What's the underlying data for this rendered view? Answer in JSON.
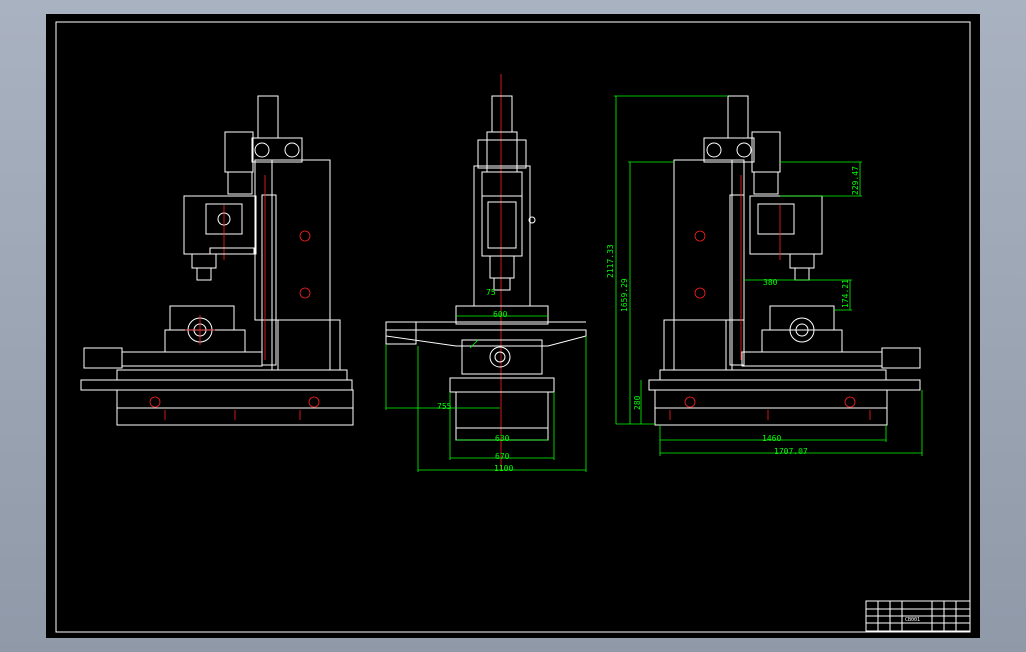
{
  "colors": {
    "background": "#000000",
    "geometry": "#ffffff",
    "dimensions": "#00ff00",
    "centerlines": "#ff2020",
    "chrome": "#9aa3b1"
  },
  "dimensions": {
    "front": {
      "d600": "600",
      "d75": "75",
      "d755": "755",
      "d630": "630",
      "d670": "670",
      "d1100": "1100"
    },
    "side": {
      "d2117": "2117.33",
      "d1659": "1659.29",
      "d229": "229.47",
      "d380": "380",
      "d174": "174.21",
      "d280": "280",
      "d1460": "1460",
      "d1707": "1707.07"
    }
  },
  "title_block": {
    "drawing_no": "CB001"
  }
}
